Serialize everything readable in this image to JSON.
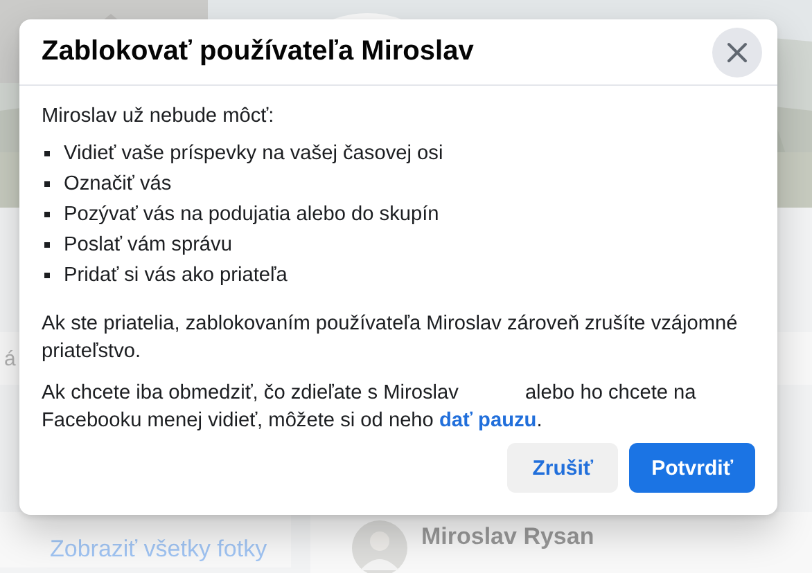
{
  "background": {
    "side_text": "á",
    "photos_link": "Zobraziť všetky fotky",
    "post_author": "Miroslav Rysan"
  },
  "dialog": {
    "title": "Zablokovať používateľa Miroslav",
    "intro": "Miroslav už nebude môcť:",
    "restrictions": [
      "Vidieť vaše príspevky na vašej časovej osi",
      "Označiť vás",
      "Pozývať vás na podujatia alebo do skupín",
      "Poslať vám správu",
      "Pridať si vás ako priateľa"
    ],
    "note": "Ak ste priatelia, zablokovaním používateľa Miroslav zároveň zrušíte vzájomné priateľstvo.",
    "hint": {
      "before": "Ak chcete iba obmedziť, čo zdieľate s Miroslav",
      "after": "alebo ho chcete na Facebooku menej vidieť, môžete si od neho",
      "link": "dať pauzu",
      "end": "."
    },
    "buttons": [
      {
        "label": "Zrušiť",
        "kind": "secondary"
      },
      {
        "label": "Potvrdiť",
        "kind": "primary"
      }
    ]
  }
}
